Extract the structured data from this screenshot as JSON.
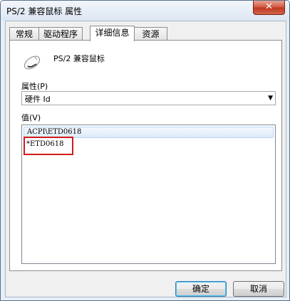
{
  "window": {
    "title": "PS/2 兼容鼠标 属性",
    "close_label": "✕"
  },
  "tabs": [
    {
      "label": "常规"
    },
    {
      "label": "驱动程序"
    },
    {
      "label": "详细信息"
    },
    {
      "label": "资源"
    }
  ],
  "active_tab": "详细信息",
  "device": {
    "name": "PS/2 兼容鼠标",
    "icon": "mouse-icon"
  },
  "property": {
    "label": "属性(P)",
    "selected_value": "硬件 Id"
  },
  "values": {
    "label": "值(V)",
    "items": [
      "ACPI\\ETD0618",
      "*ETD0618"
    ]
  },
  "buttons": {
    "ok_label": "确定",
    "cancel_label": "取消"
  },
  "colors": {
    "highlight": "#d11b1b",
    "selection": "#dfebf8"
  }
}
